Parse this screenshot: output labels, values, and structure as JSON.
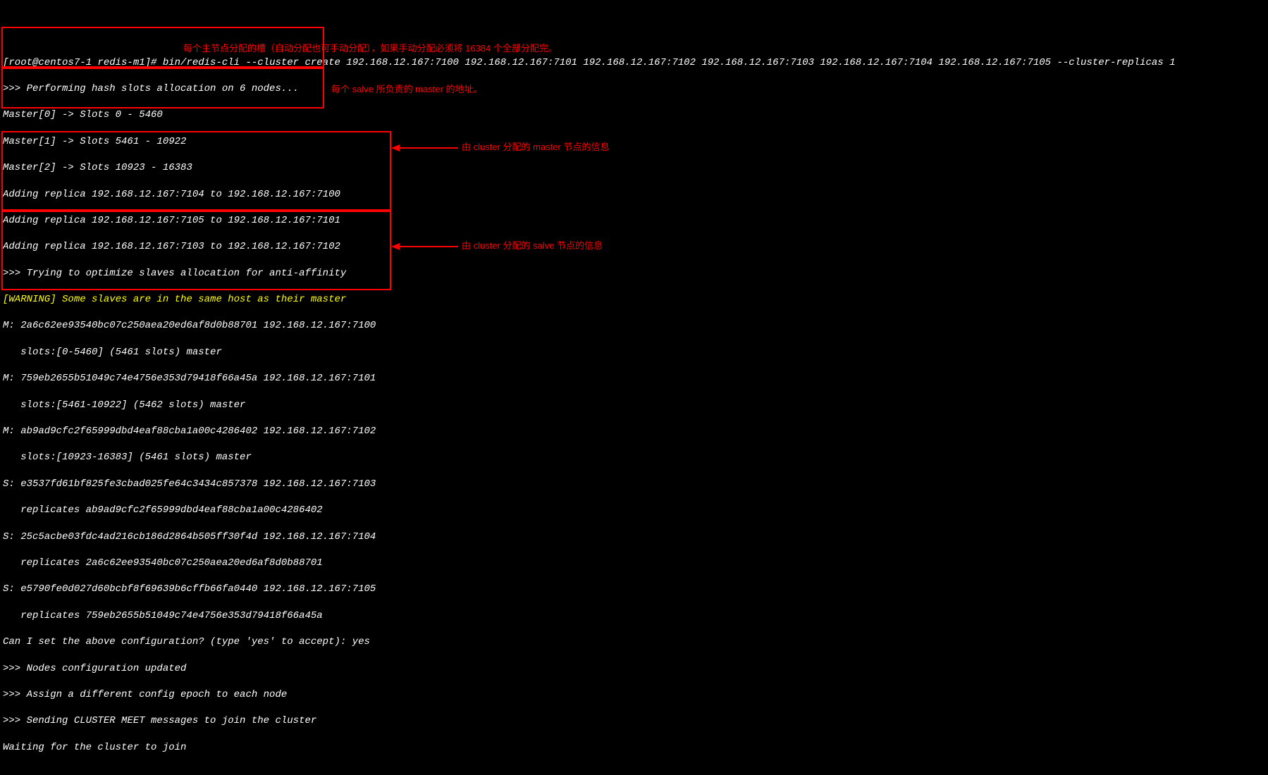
{
  "terminal": {
    "prompt": "[root@centos7-1 redis-m1]# ",
    "command": "bin/redis-cli --cluster create 192.168.12.167:7100 192.168.12.167:7101 192.168.12.167:7102 192.168.12.167:7103 192.168.12.167:7104 192.168.12.167:7105 --cluster-replicas 1",
    "lines": [
      ">>> Performing hash slots allocation on 6 nodes...",
      "Master[0] -> Slots 0 - 5460",
      "Master[1] -> Slots 5461 - 10922",
      "Master[2] -> Slots 10923 - 16383",
      "Adding replica 192.168.12.167:7104 to 192.168.12.167:7100",
      "Adding replica 192.168.12.167:7105 to 192.168.12.167:7101",
      "Adding replica 192.168.12.167:7103 to 192.168.12.167:7102",
      ">>> Trying to optimize slaves allocation for anti-affinity"
    ],
    "warning": "[WARNING] Some slaves are in the same host as their master",
    "masters": [
      "M: 2a6c62ee93540bc07c250aea20ed6af8d0b88701 192.168.12.167:7100",
      "   slots:[0-5460] (5461 slots) master",
      "M: 759eb2655b51049c74e4756e353d79418f66a45a 192.168.12.167:7101",
      "   slots:[5461-10922] (5462 slots) master",
      "M: ab9ad9cfc2f65999dbd4eaf88cba1a00c4286402 192.168.12.167:7102",
      "   slots:[10923-16383] (5461 slots) master"
    ],
    "slaves": [
      "S: e3537fd61bf825fe3cbad025fe64c3434c857378 192.168.12.167:7103",
      "   replicates ab9ad9cfc2f65999dbd4eaf88cba1a00c4286402",
      "S: 25c5acbe03fdc4ad216cb186d2864b505ff30f4d 192.168.12.167:7104",
      "   replicates 2a6c62ee93540bc07c250aea20ed6af8d0b88701",
      "S: e5790fe0d027d60bcbf8f69639b6cffb66fa0440 192.168.12.167:7105",
      "   replicates 759eb2655b51049c74e4756e353d79418f66a45a"
    ],
    "footer": [
      "Can I set the above configuration? (type 'yes' to accept): yes",
      ">>> Nodes configuration updated",
      ">>> Assign a different config epoch to each node",
      ">>> Sending CLUSTER MEET messages to join the cluster",
      "Waiting for the cluster to join"
    ]
  },
  "annotations": {
    "slots": "每个主节点分配的槽（自动分配也可手动分配），如果手动分配必须将 16384 个全部分配完。",
    "replicas": "每个 salve 所负责的 master 的地址。",
    "master_info": "由 cluster 分配的 master 节点的信息",
    "slave_info": "由 cluster 分配的 salve 节点的信息"
  }
}
